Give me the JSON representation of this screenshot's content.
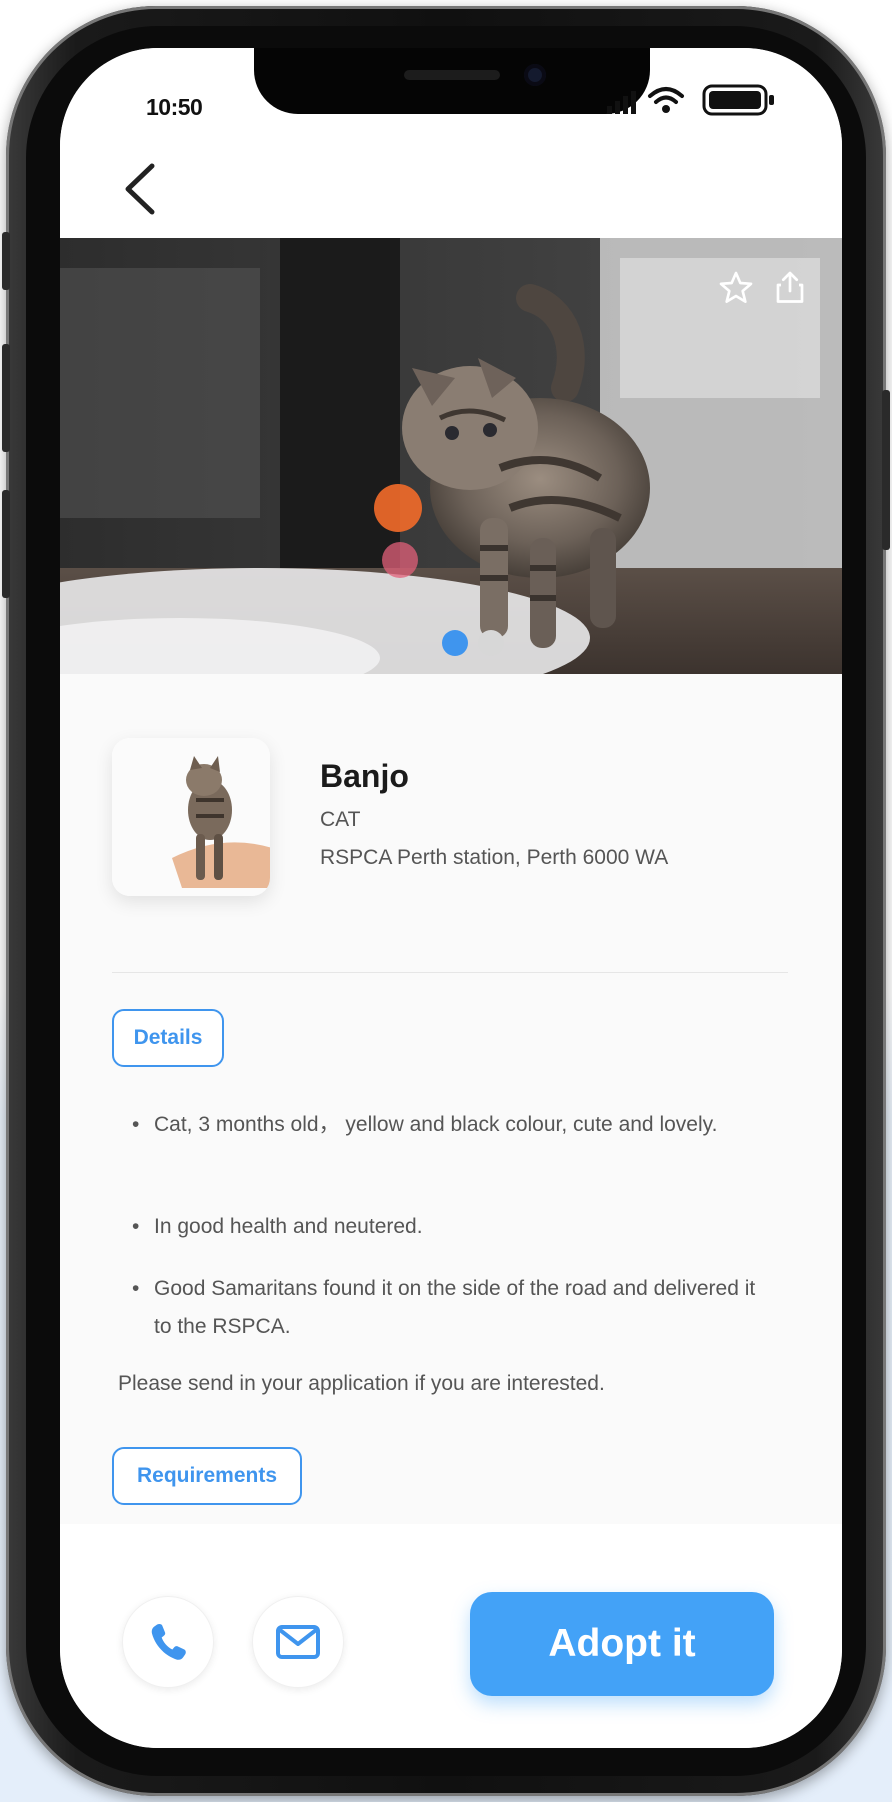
{
  "status_bar": {
    "time": "10:50"
  },
  "hero": {
    "active_slide": 1,
    "slide_count": 2
  },
  "pet": {
    "name": "Banjo",
    "type": "CAT",
    "location": "RSPCA Perth station, Perth 6000 WA"
  },
  "details": {
    "label": "Details",
    "bullets": [
      "Cat, 3 months old， yellow and black colour, cute and lovely.",
      "In good health and neutered.",
      "Good Samaritans found it on the side of the road and delivered it to the RSPCA."
    ],
    "closing": "Please send in your application if you are interested."
  },
  "requirements": {
    "label": "Requirements"
  },
  "actions": {
    "adopt_label": "Adopt it"
  },
  "colors": {
    "accent": "#43a2f7",
    "tag_border": "#3f95ee",
    "text": "#555555"
  },
  "icons": [
    "back-arrow-icon",
    "star-icon",
    "share-icon",
    "phone-icon",
    "mail-icon",
    "wifi-icon",
    "battery-icon",
    "signal-icon"
  ]
}
